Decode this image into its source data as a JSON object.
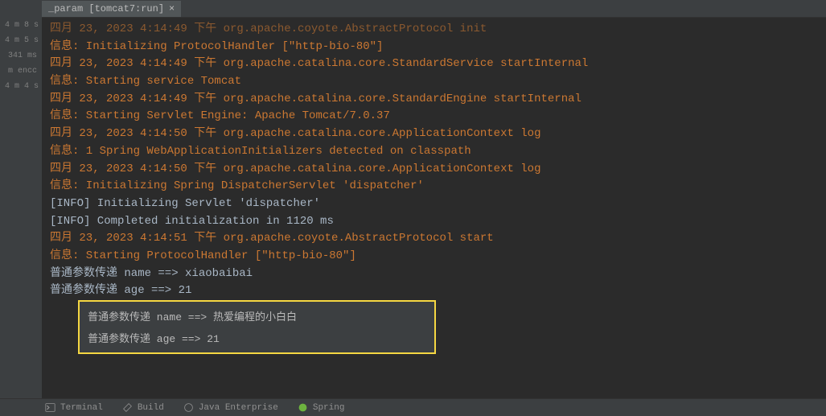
{
  "tab": {
    "label": "_param [tomcat7:run]",
    "close": "×"
  },
  "sidebar": {
    "items": [
      "4 m 8 s",
      "4 m 5 s",
      "341 ms",
      "m encc",
      "4 m 4 s"
    ]
  },
  "console": {
    "lines": [
      {
        "cls": "log-line",
        "text": "四月 23, 2023 4:14:49 下午 org.apache.coyote.AbstractProtocol init"
      },
      {
        "cls": "log-line",
        "text": "信息: Initializing ProtocolHandler [\"http-bio-80\"]"
      },
      {
        "cls": "log-line",
        "text": "四月 23, 2023 4:14:49 下午 org.apache.catalina.core.StandardService startInternal"
      },
      {
        "cls": "log-line",
        "text": "信息: Starting service Tomcat"
      },
      {
        "cls": "log-line",
        "text": "四月 23, 2023 4:14:49 下午 org.apache.catalina.core.StandardEngine startInternal"
      },
      {
        "cls": "log-line",
        "text": "信息: Starting Servlet Engine: Apache Tomcat/7.0.37"
      },
      {
        "cls": "log-line",
        "text": "四月 23, 2023 4:14:50 下午 org.apache.catalina.core.ApplicationContext log"
      },
      {
        "cls": "log-line",
        "text": "信息: 1 Spring WebApplicationInitializers detected on classpath"
      },
      {
        "cls": "log-line",
        "text": "四月 23, 2023 4:14:50 下午 org.apache.catalina.core.ApplicationContext log"
      },
      {
        "cls": "log-line",
        "text": "信息: Initializing Spring DispatcherServlet 'dispatcher'"
      },
      {
        "cls": "log-line white",
        "text": "[INFO] Initializing Servlet 'dispatcher'"
      },
      {
        "cls": "log-line white",
        "text": "[INFO] Completed initialization in 1120 ms"
      },
      {
        "cls": "log-line",
        "text": "四月 23, 2023 4:14:51 下午 org.apache.coyote.AbstractProtocol start"
      },
      {
        "cls": "log-line",
        "text": "信息: Starting ProtocolHandler [\"http-bio-80\"]"
      },
      {
        "cls": "log-line white",
        "text": "普通参数传递 name ==> xiaobaibai"
      },
      {
        "cls": "log-line white",
        "text": "普通参数传递 age ==> 21"
      }
    ],
    "highlighted": [
      "普通参数传递 name ==> 热爱编程的小白白",
      "普通参数传递 age ==> 21"
    ]
  },
  "bottom": {
    "items": [
      "Terminal",
      "Build",
      "Java Enterprise",
      "Spring"
    ]
  }
}
